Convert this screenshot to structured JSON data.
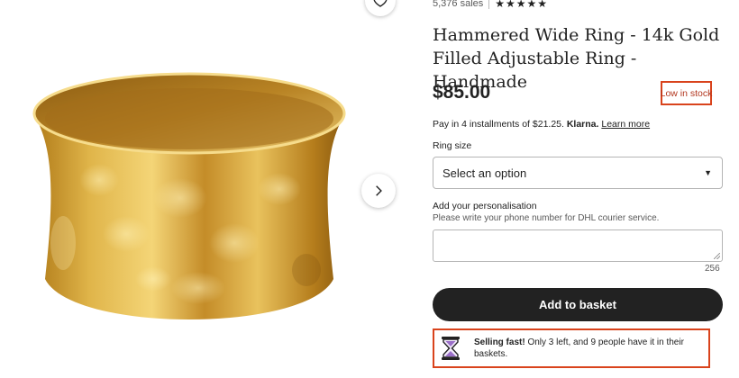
{
  "product": {
    "sales_count": "5,376 sales",
    "rating_stars": "★★★★★",
    "title": "Hammered Wide Ring - 14k Gold Filled Adjustable Ring - Handmade",
    "price": "$85.00",
    "stock_badge": "Low in stock"
  },
  "payment": {
    "prefix": "Pay in 4 installments of $21.25.",
    "provider": "Klarna.",
    "link": "Learn more"
  },
  "ring_size": {
    "label": "Ring size",
    "selected": "Select an option"
  },
  "personalisation": {
    "label": "Add your personalisation",
    "help": "Please write your phone number for DHL courier service.",
    "value": "",
    "char_count": "256"
  },
  "actions": {
    "add_to_basket": "Add to basket"
  },
  "notice": {
    "bold": "Selling fast!",
    "text": " Only 3 left, and 9 people have it in their baskets."
  },
  "icons": {
    "favorite": "heart-icon",
    "next": "chevron-right-icon",
    "dropdown": "caret-down-icon",
    "notice": "hourglass-icon"
  },
  "colors": {
    "accent_red": "#d9431c",
    "button_dark": "#222222",
    "hourglass_purple": "#9b6fc9"
  }
}
